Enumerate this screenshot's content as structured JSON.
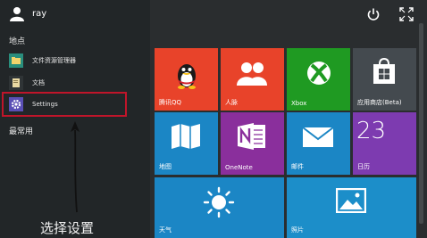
{
  "user": {
    "name": "ray"
  },
  "sections": {
    "places": "地点",
    "most_used": "最常用"
  },
  "menu_items": [
    {
      "label": "文件资源管理器",
      "icon": "file-explorer-icon"
    },
    {
      "label": "文档",
      "icon": "documents-icon"
    },
    {
      "label": "Settings",
      "icon": "gear-icon"
    }
  ],
  "annotation": "选择设置",
  "tiles": [
    {
      "label": "腾讯QQ",
      "color": "#e8432a",
      "icon": "qq-penguin-icon"
    },
    {
      "label": "人脉",
      "color": "#e8432a",
      "icon": "people-icon"
    },
    {
      "label": "Xbox",
      "color": "#1f9a22",
      "icon": "xbox-icon"
    },
    {
      "label": "应用商店(Beta)",
      "color": "#444a4f",
      "icon": "store-bag-icon"
    },
    {
      "label": "地图",
      "color": "#1b86c5",
      "icon": "map-icon"
    },
    {
      "label": "OneNote",
      "color": "#8a2f9c",
      "icon": "onenote-icon"
    },
    {
      "label": "邮件",
      "color": "#1b86c5",
      "icon": "mail-icon"
    },
    {
      "label": "日历",
      "color": "#7d3bb0",
      "icon": "calendar-icon",
      "big_text": "23"
    },
    {
      "label": "天气",
      "color": "#1b86c5",
      "icon": "sun-icon"
    },
    {
      "label": "照片",
      "color": "#1c8ec9",
      "icon": "photo-icon"
    }
  ]
}
